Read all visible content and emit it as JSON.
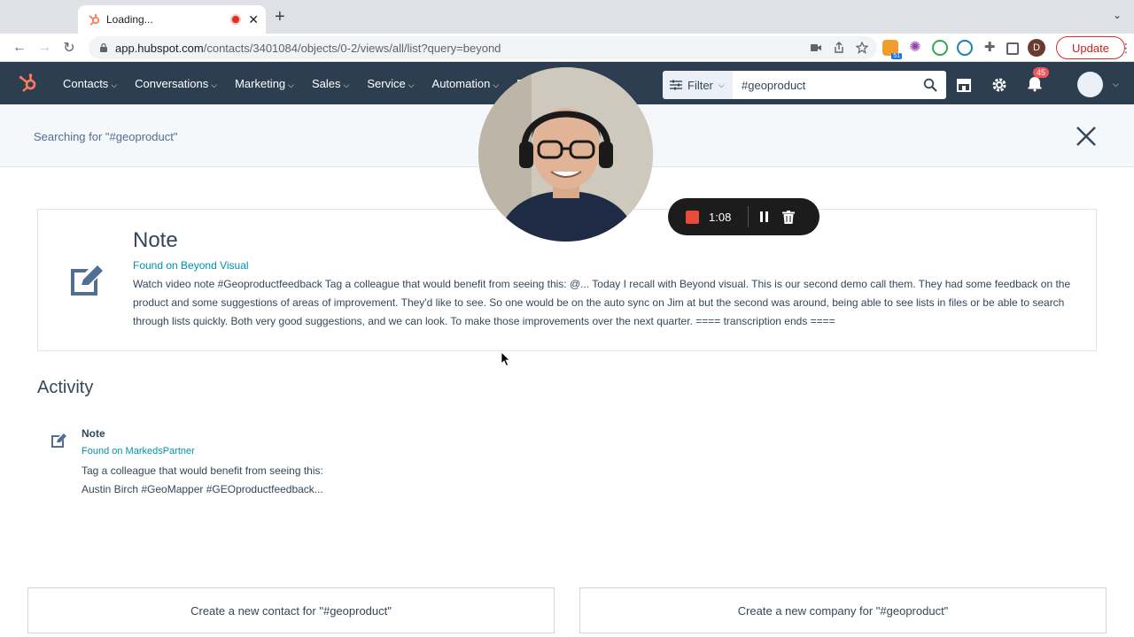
{
  "browser": {
    "tab_title": "Loading...",
    "url_host": "app.hubspot.com",
    "url_path": "/contacts/3401084/objects/0-2/views/all/list?query=beyond",
    "update_label": "Update",
    "profile_initial": "D",
    "ext_badge": "51"
  },
  "hubspot": {
    "nav_items": [
      "Contacts",
      "Conversations",
      "Marketing",
      "Sales",
      "Service",
      "Automation",
      "R"
    ],
    "filter_label": "Filter",
    "search_value": "#geoproduct",
    "notification_count": "45"
  },
  "search": {
    "searching_text": "Searching for \"#geoproduct\""
  },
  "note_card": {
    "title": "Note",
    "found_on": "Found on Beyond Visual",
    "body": "Watch video note #Geoproductfeedback Tag a colleague that would benefit from seeing this: @... Today I recall with Beyond visual. This is our second demo call them. They had some feedback on the product and some suggestions of areas of improvement. They'd like to see. So one would be on the auto sync on Jim at but the second was around, being able to see lists in files or be able to search through lists quickly. Both very good suggestions, and we can look. To make those improvements over the next quarter. ==== transcription ends ===="
  },
  "activity": {
    "heading": "Activity",
    "item_title": "Note",
    "item_found_on": "Found on MarkedsPartner",
    "item_body_line1": "Tag a colleague that would benefit from seeing this:",
    "item_body_line2": "Austin Birch #GeoMapper #GEOproductfeedback..."
  },
  "actions": {
    "create_contact": "Create a new contact for \"#geoproduct\"",
    "create_company": "Create a new company for \"#geoproduct\""
  },
  "recorder": {
    "elapsed": "1:08"
  },
  "colors": {
    "nav_bg": "#2d3e50",
    "link": "#0091ae",
    "record_red": "#e84a3c",
    "hubspot_orange": "#ff7a59"
  }
}
